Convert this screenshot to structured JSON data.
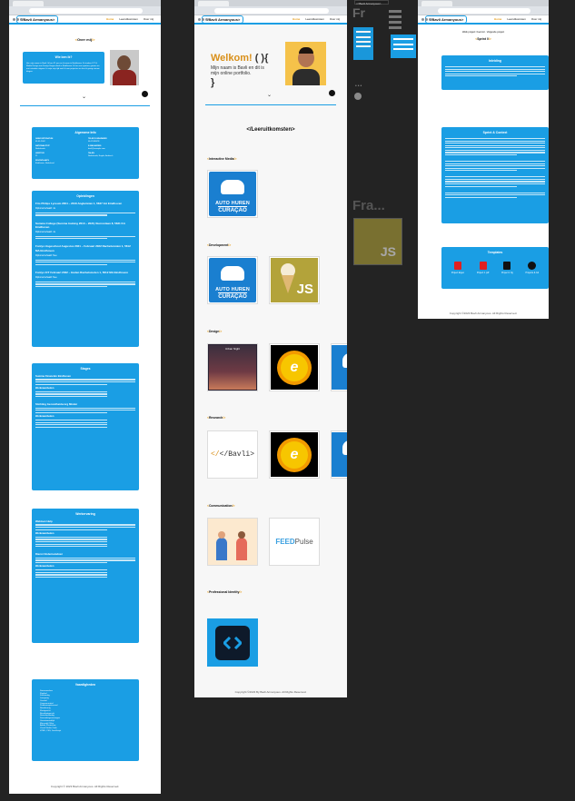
{
  "portfolio_home": {
    "logo": "</Bavli Armanyous>",
    "nav": [
      "Home",
      "Leeruitkomsten",
      "Over mij"
    ],
    "section_over_mij": "Over mij",
    "intro_title": "Wie ben ik?",
    "intro_text": "Hoi, mijn naam is Bavli. Ik ben 21 jaar en ik woon in Eindhoven. Ik studeer ICT & Media Design aan Fontys Hogeschool in Eindhoven. Ik hou van sporten, gamen en met vrienden uitgaan. In mijn vrije tijd werk ik aan projecten en leer ik graag nieuwe dingen.",
    "general_info_title": "Algemene Info",
    "general_info": [
      {
        "label": "GEBOORTEDATUM",
        "value": "01-01-2002"
      },
      {
        "label": "TELEFOONNUMMER",
        "value": "06-12345678"
      },
      {
        "label": "NATIONALITEIT",
        "value": "Nederlands"
      },
      {
        "label": "E-MAILADRES",
        "value": "bavli@example.com"
      },
      {
        "label": "LEEFTIJD",
        "value": "21"
      },
      {
        "label": "TALEN",
        "value": "Nederlands, Engels, Arabisch"
      },
      {
        "label": "WOONPLAATS",
        "value": "Eindhoven, Nederland"
      }
    ],
    "education_title": "Opleidingen",
    "education": [
      {
        "title": "Fris Philips Lyceum 2004 – 2016 Anglaristan 1, 5627 GA Eindhoven",
        "sub": "Diploma behaald: Ja"
      },
      {
        "title": "Summa College (Summa training 2013 – 2021) Sterrenlaan 8, 5631 KA Eindhoven",
        "sub": "Diploma behaald: Ja"
      },
      {
        "title": "Fontys Hogeschool Augustus 2021 – Februari 2022 Rachelsmolen 1, 5612 MA Eindhoven",
        "sub": "Diploma behaald: Nee"
      },
      {
        "title": "Fontys ICT Februari 2022 – Heden Rachelsmolen 1, 5612 MA Eindhoven",
        "sub": "Diploma behaald: Nee"
      }
    ],
    "internships_title": "Stages",
    "internships": [
      {
        "title": "Summa Financiën Eindhoven",
        "sub": "Werkzaamheden"
      },
      {
        "title": "Stichting Gezondheidszorg Minder",
        "sub": "Werkzaamheden"
      }
    ],
    "work_title": "Werkervaring",
    "work": [
      {
        "title": "Webtoen Hulp",
        "sub": "Werkzaamheden"
      },
      {
        "title": "Dienst Ondernamdsier",
        "sub": "Werkzaamheden"
      }
    ],
    "skills_title": "Vaardigheden",
    "skills": [
      "Samenwerken",
      "Flexibel",
      "Zelfstandig",
      "Leergierig",
      "Creatief",
      "Communicatief",
      "Probleemoplossend",
      "Nauwkeurig",
      "Klantgericht",
      "Resultaatgericht",
      "Stressbestendig",
      "Doorzettingsvermogen",
      "Verantwoordelijk",
      "Microsoft Office",
      "Adobe Photoshop",
      "Visual Studio Code",
      "HTML, CSS, JavaScript"
    ],
    "footer": "Copyright © 2023 Bavli Armanyous. All Rights Reserved."
  },
  "portfolio_outcomes": {
    "logo": "</Bavli Armanyous>",
    "nav": [
      "Home",
      "Leeruitkomsten",
      "Over mij"
    ],
    "hero_welcome": "Welkom!",
    "hero_parens": "( ){",
    "hero_text": "Mijn naam is Bavli en dit is mijn online portfolio.",
    "hero_close": "}",
    "title": "</Leeruitkomsten>",
    "categories": [
      "Interactive Media",
      "Development",
      "Design",
      "Research",
      "Communication",
      "Professional Identity"
    ],
    "tile_labels": {
      "car_line1": "AUTO HUREN",
      "car_line2": "CURAÇAO",
      "js": "JS",
      "bavli": "</Bavli>",
      "feed": "FEED",
      "pulse": "Pulse",
      "design_shot": "Urban Night",
      "sun": "e"
    },
    "footer": "Copyright ©2023 By Bavli Armanyous. All Rights Reserved."
  },
  "portfolio_project": {
    "logo": "</Bavli Armanyous>",
    "nav": [
      "Home",
      "Leeruitkomsten",
      "Over mij"
    ],
    "breadcrumb": "Welk project: Fuel Ad · Volgende project",
    "section": "Sprint 0",
    "intro_title": "Inleiding",
    "context_title": "Sprint & Context",
    "templates_title": "Templates",
    "templates": [
      {
        "label": "Project Eigen",
        "icon": "#e02020"
      },
      {
        "label": "Project 1 pdf",
        "icon": "#e02020"
      },
      {
        "label": "Project 1 fig",
        "icon": "#111"
      },
      {
        "label": "Projects & Git",
        "icon": "#111"
      }
    ],
    "footer": "Copyright ©2023 Bavli Armanyous. All Rights Reserved."
  },
  "floating": {
    "label_top": "</ Bavli Armanyous>",
    "fra_text": "Fra...",
    "js_text": "JS"
  }
}
